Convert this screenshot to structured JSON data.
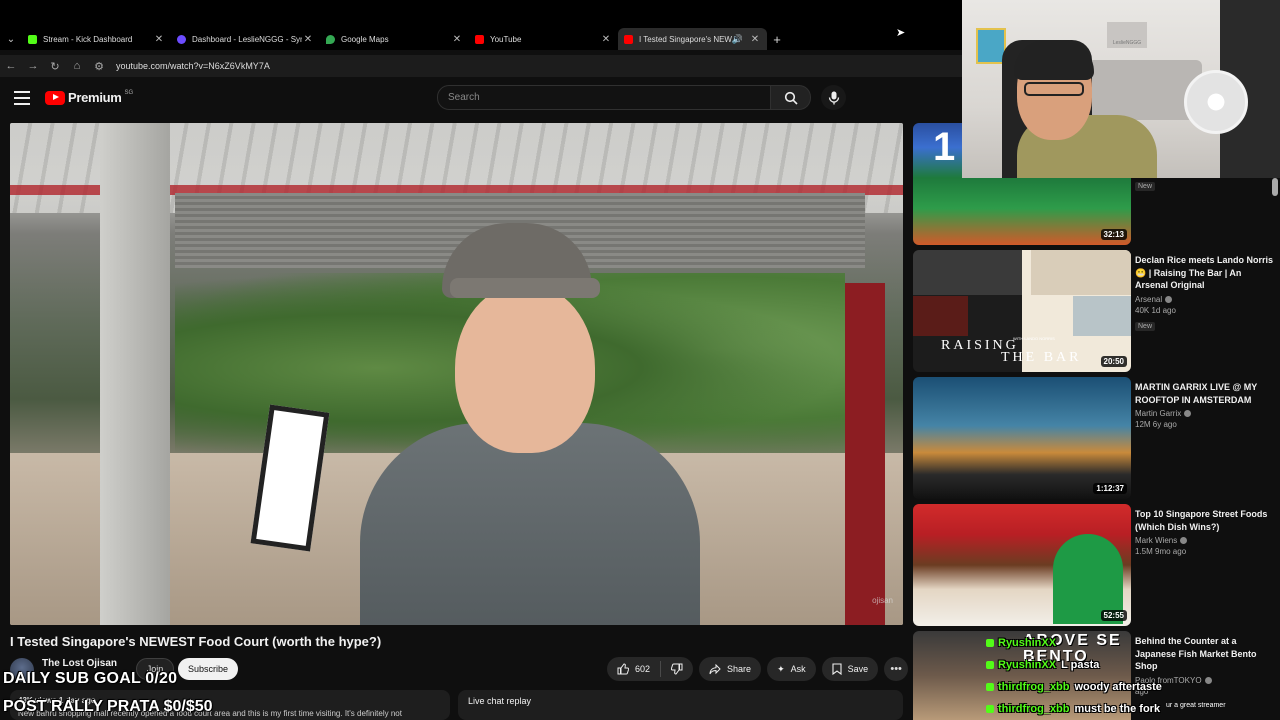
{
  "browser": {
    "tabs": [
      {
        "title": "Stream - Kick Dashboard",
        "color": "#53fc18",
        "active": false
      },
      {
        "title": "Dashboard - LeslieNGGG - Syn",
        "color": "#6c4cff",
        "active": false
      },
      {
        "title": "Google Maps",
        "color": "#34a853",
        "active": false
      },
      {
        "title": "YouTube",
        "color": "#ff0000",
        "active": false
      },
      {
        "title": "I Tested Singapore's NEWE",
        "color": "#ff0000",
        "active": true
      }
    ],
    "url": "youtube.com/watch?v=N6xZ6VkMY7A"
  },
  "header": {
    "logo_text": "Premium",
    "logo_region": "SG",
    "search_placeholder": "Search"
  },
  "video": {
    "title": "I Tested Singapore's NEWEST Food Court (worth the hype?)",
    "channel": "The Lost Ojisan",
    "join_label": "Join",
    "subscribe_label": "Subscribe",
    "likes": "602",
    "share_label": "Share",
    "ask_label": "Ask",
    "save_label": "Save",
    "description_meta": "43K views  1 day ago",
    "description_text": "New bahru shopping mall recently opened a food court area and this is my first time visiting. It's definitely not",
    "chat_replay_label": "Live chat replay",
    "watermark": "ojisan"
  },
  "stream_overlay": {
    "sub_goal": "DAILY SUB GOAL 0/20",
    "rally": "POST RALLY PRATA $0/$50",
    "webcam_sign": "LeslieNGGG"
  },
  "recommendations": [
    {
      "title": "",
      "channel": "",
      "meta": "",
      "duration": "32:13",
      "badge": "New",
      "thumb_text": "1"
    },
    {
      "title": "Declan Rice meets Lando Norris 😬 | Raising The Bar | An Arsenal Original",
      "channel": "Arsenal",
      "meta": "40K  1d ago",
      "duration": "20:50",
      "badge": "New",
      "thumb_text_1": "RAISING",
      "thumb_text_2": "THE BAR",
      "thumb_small": "WITH LANDO NORRIS"
    },
    {
      "title": "MARTIN GARRIX LIVE @ MY ROOFTOP IN AMSTERDAM",
      "channel": "Martin Garrix",
      "meta": "12M  6y ago",
      "duration": "1:12:37"
    },
    {
      "title": "Top 10 Singapore Street Foods (Which Dish Wins?)",
      "channel": "Mark Wiens",
      "meta": "1.5M  9mo ago",
      "duration": "52:55"
    },
    {
      "title": "Behind the Counter at a Japanese Fish Market Bento Shop",
      "channel": "Paolo fromTOKYO",
      "meta": "ago",
      "thumb_text": "ABOVE SE BENTO"
    }
  ],
  "chat": [
    {
      "user": "RyushinXX",
      "message": ""
    },
    {
      "user": "RyushinXX",
      "message": "L pasta"
    },
    {
      "user": "thirdfrog_xbb",
      "message": "woody aftertaste"
    },
    {
      "user": "thirdfrog_xbb",
      "message": "must be the fork"
    }
  ],
  "chat_extra": "ur a great streamer"
}
